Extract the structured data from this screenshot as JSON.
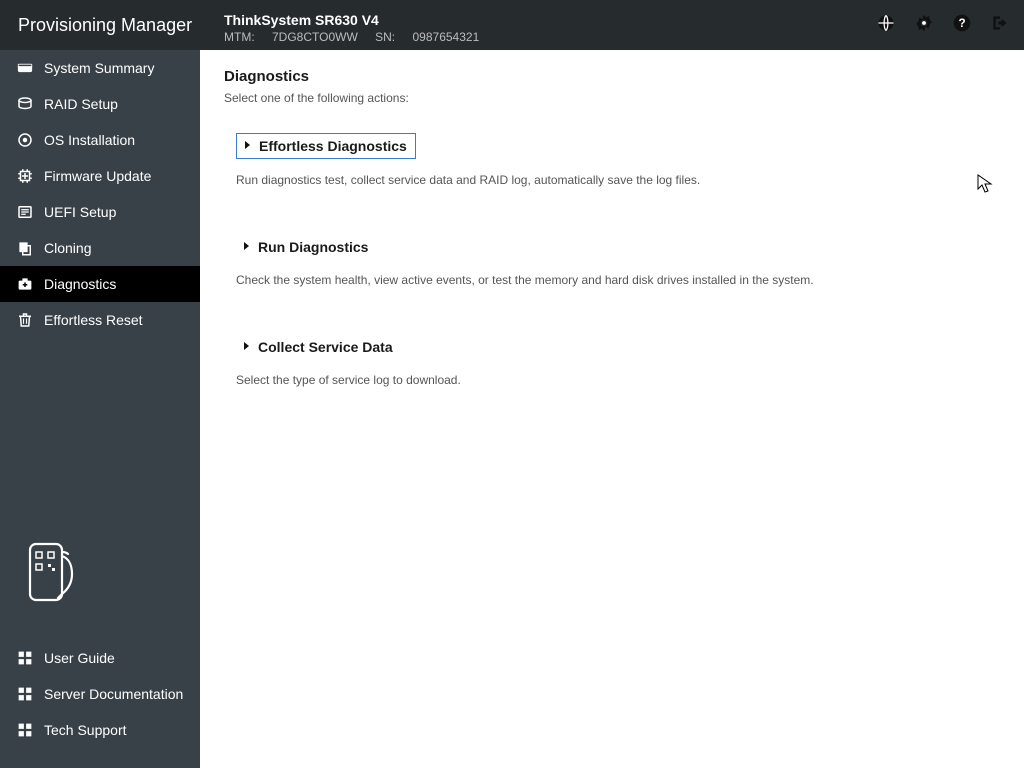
{
  "header": {
    "brand": "Provisioning Manager",
    "system_name": "ThinkSystem SR630 V4",
    "mtm_label": "MTM:",
    "mtm_value": "7DG8CTO0WW",
    "sn_label": "SN:",
    "sn_value": "0987654321"
  },
  "sidebar": {
    "items": [
      {
        "label": "System Summary"
      },
      {
        "label": "RAID Setup"
      },
      {
        "label": "OS Installation"
      },
      {
        "label": "Firmware Update"
      },
      {
        "label": "UEFI Setup"
      },
      {
        "label": "Cloning"
      },
      {
        "label": "Diagnostics"
      },
      {
        "label": "Effortless Reset"
      }
    ],
    "bottom": [
      {
        "label": "User Guide"
      },
      {
        "label": "Server Documentation"
      },
      {
        "label": "Tech Support"
      }
    ]
  },
  "main": {
    "title": "Diagnostics",
    "subtitle": "Select one of the following actions:",
    "options": [
      {
        "title": "Effortless Diagnostics",
        "desc": "Run diagnostics test, collect service data and RAID log, automatically save the log files."
      },
      {
        "title": "Run Diagnostics",
        "desc": "Check the system health, view active events, or test the memory and hard disk drives installed in the system."
      },
      {
        "title": "Collect Service Data",
        "desc": "Select the type of service log to download."
      }
    ]
  }
}
